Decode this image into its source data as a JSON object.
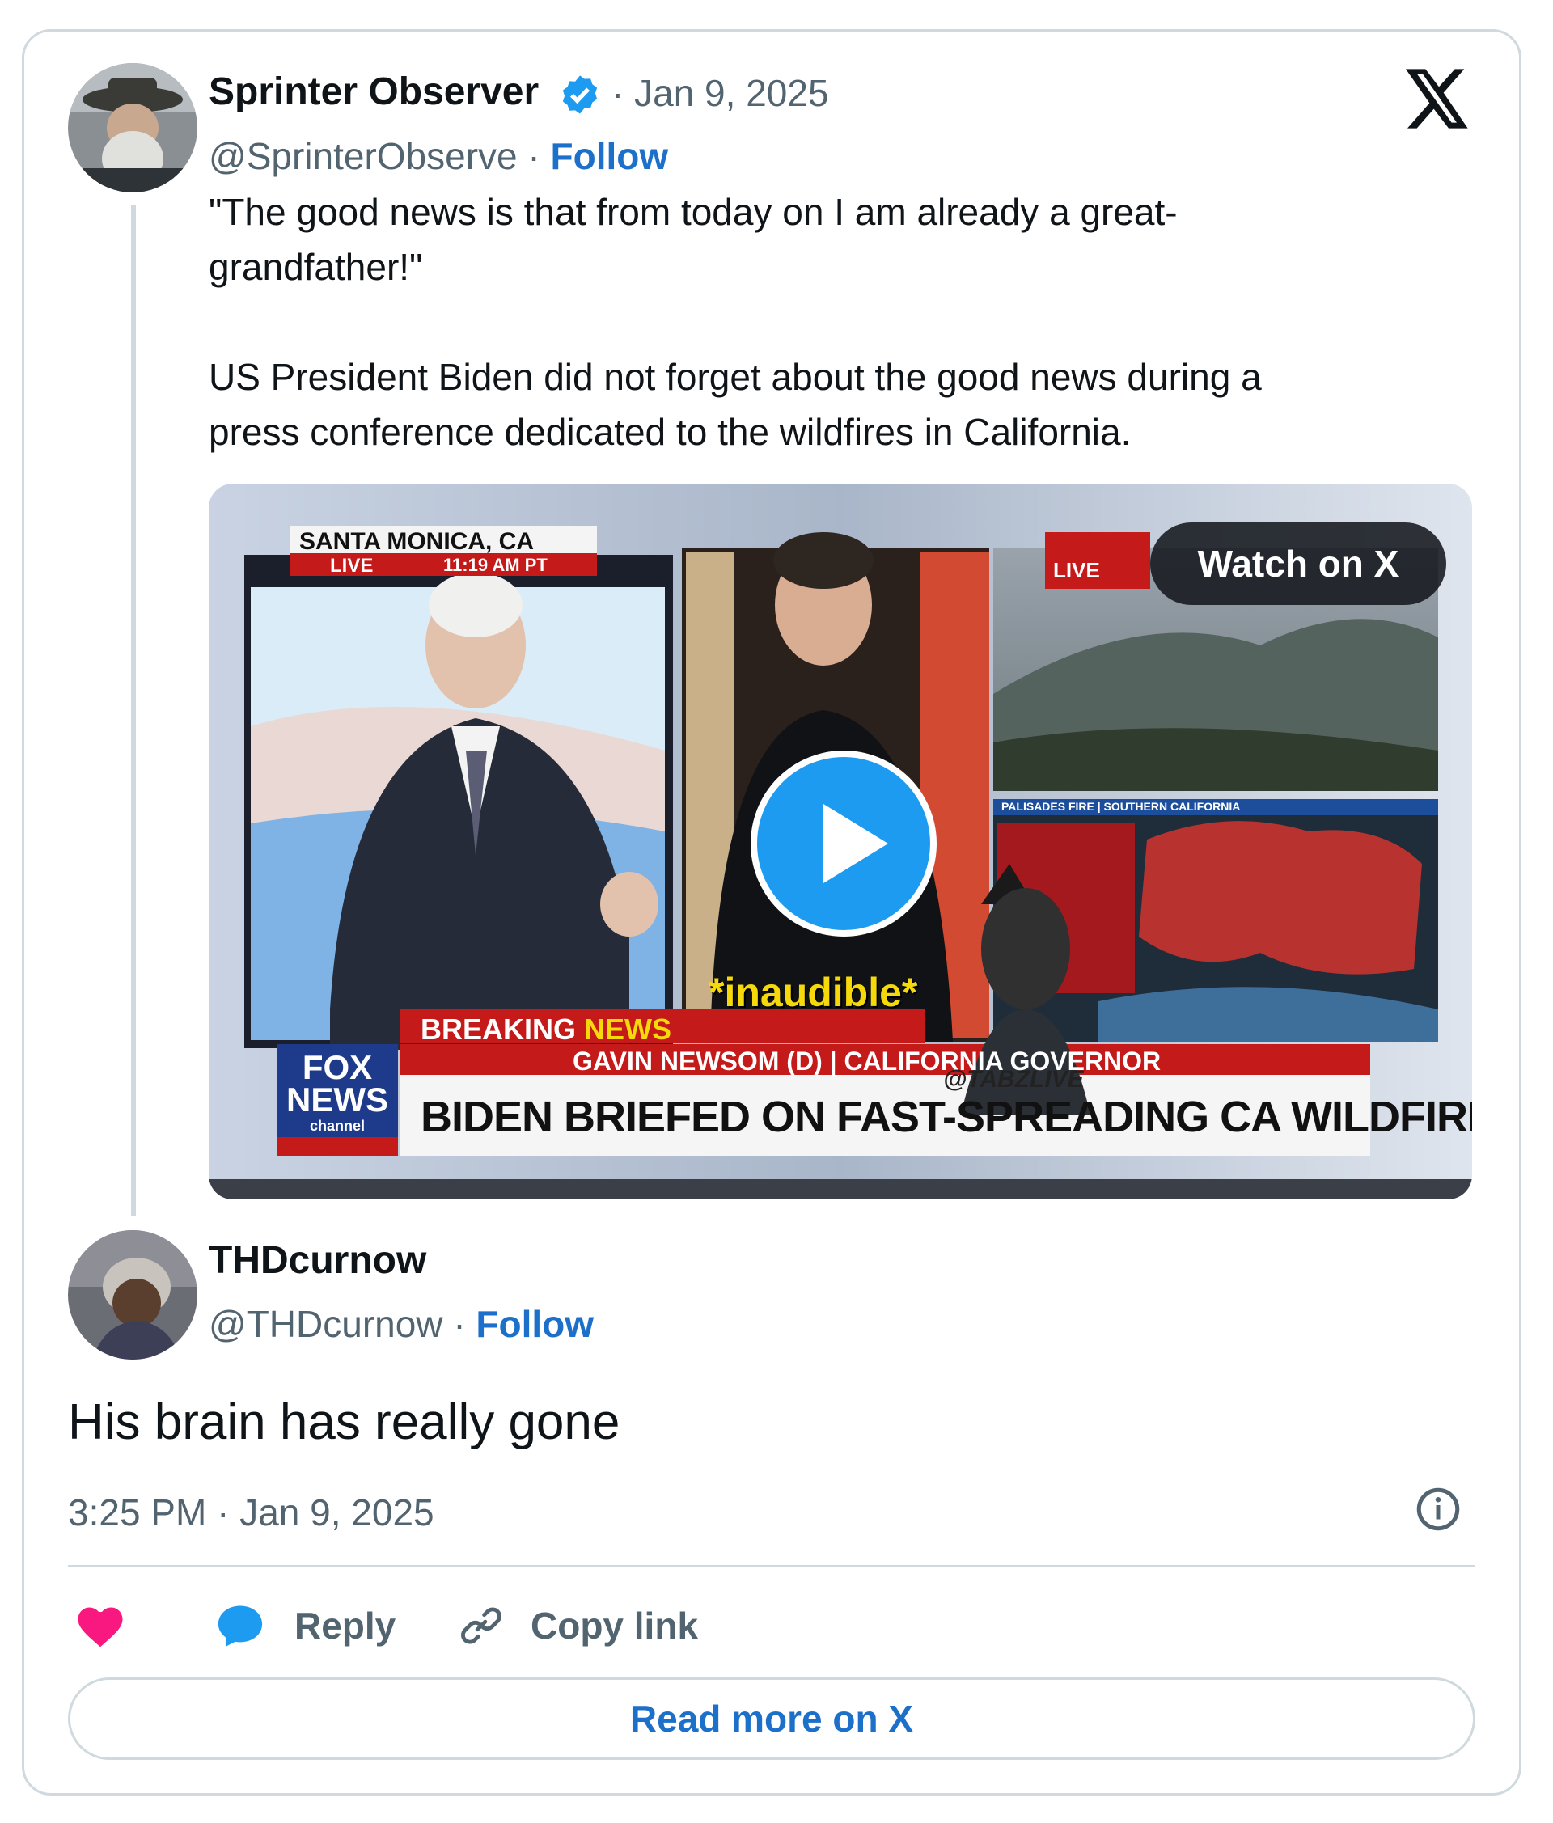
{
  "quoted_post": {
    "author_name": "Sprinter Observer",
    "date": "Jan 9, 2025",
    "handle": "@SprinterObserve",
    "follow_label": "Follow",
    "text": "\"The good news is that from today on I am already a great-\ngrandfather!\"\n\nUS President Biden did not forget about the good news during a\npress conference dedicated to the wildfires in California.",
    "media": {
      "watch_label": "Watch on X",
      "overlay": {
        "location": "SANTA MONICA, CA",
        "live": "LIVE",
        "live_time": "11:19 AM PT",
        "live_right": "LIVE",
        "caption": "*inaudible*",
        "breaking": "BREAKING",
        "news": "NEWS",
        "subtitle": "GAVIN NEWSOM (D) | CALIFORNIA GOVERNOR",
        "watermark": "@TABZLIVE",
        "headline": "BIDEN BRIEFED ON FAST-SPREADING CA WILDFIRES",
        "map_header": "PALISADES FIRE | SOUTHERN CALIFORNIA",
        "logo_line1": "FOX",
        "logo_line2": "NEWS",
        "logo_line3": "channel"
      }
    }
  },
  "reply_post": {
    "author_name": "THDcurnow",
    "handle": "@THDcurnow",
    "follow_label": "Follow",
    "text": "His brain has really gone",
    "timestamp": "3:25 PM · Jan 9, 2025"
  },
  "actions": {
    "reply_label": "Reply",
    "copy_link_label": "Copy link",
    "read_more_label": "Read more on X"
  },
  "colors": {
    "accent_blue": "#1d9bf0",
    "link_blue": "#1d70c9",
    "like_pink": "#f91880",
    "muted_gray": "#536471",
    "border_gray": "#cfd9de"
  },
  "icons": [
    "verified-badge-icon",
    "x-logo-icon",
    "heart-icon",
    "reply-bubble-icon",
    "link-icon",
    "info-icon",
    "play-icon"
  ]
}
